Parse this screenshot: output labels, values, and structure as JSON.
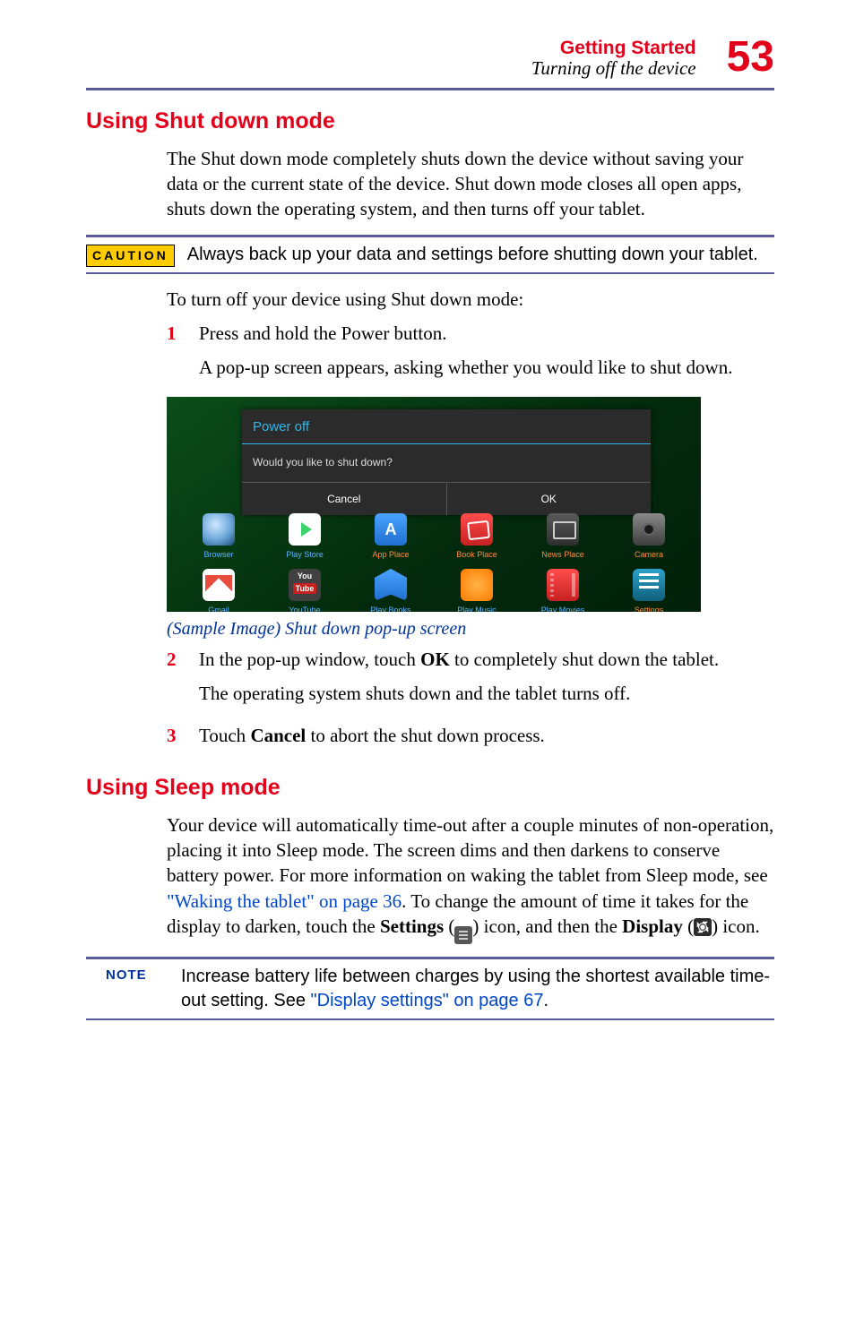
{
  "header": {
    "chapter": "Getting Started",
    "section": "Turning off the device",
    "page": "53"
  },
  "title1": "Using Shut down mode",
  "para1": "The Shut down mode completely shuts down the device without saving your data or the current state of the device. Shut down mode closes all open apps, shuts down the operating system, and then turns off your tablet.",
  "caution": {
    "label": "CAUTION",
    "text": "Always back up your data and settings before shutting down your tablet."
  },
  "para2": "To turn off your device using Shut down mode:",
  "steps_a": {
    "s1": {
      "n": "1",
      "t1": "Press and hold the Power button.",
      "t2": "A pop-up screen appears, asking whether you would like to shut down."
    }
  },
  "figure": {
    "caption": "(Sample Image) Shut down pop-up screen",
    "dialog": {
      "title": "Power off",
      "prompt": "Would you like to shut down?",
      "cancel": "Cancel",
      "ok": "OK"
    },
    "apps_top": {
      "a0": "Browser",
      "a1": "Play Store",
      "a2": "App Place",
      "a3": "Book Place",
      "a4": "News Place",
      "a5": "Camera"
    },
    "apps_bottom": {
      "b0": "Gmail",
      "b1": "YouTube",
      "b2": "Play Books",
      "b3": "Play Music",
      "b4": "Play Movies",
      "b5": "Settings"
    }
  },
  "steps_b": {
    "s2": {
      "n": "2",
      "t1a": "In the pop-up window, touch ",
      "t1b": "OK",
      "t1c": " to completely shut down the tablet.",
      "t2": "The operating system shuts down and the tablet turns off."
    },
    "s3": {
      "n": "3",
      "t1a": "Touch ",
      "t1b": "Cancel",
      "t1c": " to abort the shut down process."
    }
  },
  "title2": "Using Sleep mode",
  "para3a": "Your device will automatically time-out after a couple minutes of non-operation, placing it into Sleep mode. The screen dims and then darkens to conserve battery power. For more information on waking the tablet from Sleep mode, see ",
  "para3link1": "\"Waking the tablet\" on page 36",
  "para3b": ". To change the amount of time it takes for the display to darken, touch the ",
  "para3bold1": "Settings",
  "para3c": " (",
  "para3d": ") icon, and then the ",
  "para3bold2": "Display",
  "para3e": " (",
  "para3f": ") icon.",
  "note": {
    "label": "NOTE",
    "t1": "Increase battery life between charges by using the shortest available time-out setting. See ",
    "link": "\"Display settings\" on page 67",
    "t2": "."
  }
}
